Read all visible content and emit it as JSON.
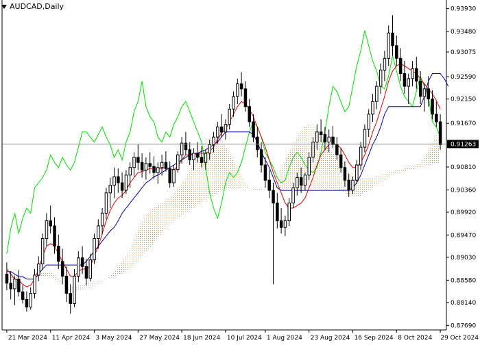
{
  "chart_title": "AUDCAD,Daily",
  "colors": {
    "background": "#ffffff",
    "axis": "#000000",
    "candle": "#000000",
    "tenkan": "#e00000",
    "kijun": "#0000aa",
    "chikou": "#00dd00",
    "cloud_bull": "#d2955a",
    "cloud_bear": "#b0a8c8",
    "price_marker_bg": "#000000",
    "price_marker_text": "#ffffff"
  },
  "chart_data": {
    "type": "candlestick",
    "symbol": "AUDCAD",
    "timeframe": "Daily",
    "indicators": [
      "Ichimoku Kinko Hyo"
    ],
    "ylim": [
      0.876,
      0.941
    ],
    "y_ticks": [
      "0.93930",
      "0.93480",
      "0.93075",
      "0.92590",
      "0.92150",
      "0.91670",
      "0.91263",
      "0.90810",
      "0.90360",
      "0.89920",
      "0.89470",
      "0.89030",
      "0.88580",
      "0.88140",
      "0.87690"
    ],
    "x_ticks": [
      "21 Mar 2024",
      "11 Apr 2024",
      "3 May 2024",
      "27 May 2024",
      "18 Jun 2024",
      "10 Jul 2024",
      "1 Aug 2024",
      "23 Aug 2024",
      "16 Sep 2024",
      "8 Oct 2024",
      "29 Oct 2024"
    ],
    "current_price": "0.91263",
    "candles": [
      [
        0.887,
        0.8893,
        0.8838,
        0.8852
      ],
      [
        0.8852,
        0.8875,
        0.882,
        0.8841
      ],
      [
        0.8841,
        0.8866,
        0.8809,
        0.886
      ],
      [
        0.886,
        0.8878,
        0.8826,
        0.8835
      ],
      [
        0.8835,
        0.8848,
        0.8812,
        0.882
      ],
      [
        0.882,
        0.8836,
        0.8796,
        0.8805
      ],
      [
        0.8805,
        0.8844,
        0.88,
        0.8832
      ],
      [
        0.8832,
        0.888,
        0.8822,
        0.8868
      ],
      [
        0.8868,
        0.8905,
        0.8856,
        0.889
      ],
      [
        0.889,
        0.895,
        0.8878,
        0.894
      ],
      [
        0.894,
        0.899,
        0.8926,
        0.8975
      ],
      [
        0.8975,
        0.9005,
        0.895,
        0.8965
      ],
      [
        0.8965,
        0.8982,
        0.891,
        0.8925
      ],
      [
        0.8925,
        0.8948,
        0.888,
        0.8895
      ],
      [
        0.8895,
        0.892,
        0.885,
        0.8866
      ],
      [
        0.8866,
        0.8885,
        0.8815,
        0.8832
      ],
      [
        0.8832,
        0.885,
        0.8792,
        0.8812
      ],
      [
        0.8812,
        0.888,
        0.8805,
        0.8866
      ],
      [
        0.8866,
        0.8915,
        0.8854,
        0.8902
      ],
      [
        0.8902,
        0.8925,
        0.887,
        0.8885
      ],
      [
        0.8885,
        0.89,
        0.8848,
        0.8862
      ],
      [
        0.8862,
        0.891,
        0.8856,
        0.8898
      ],
      [
        0.8898,
        0.895,
        0.889,
        0.894
      ],
      [
        0.894,
        0.8978,
        0.892,
        0.8965
      ],
      [
        0.8965,
        0.9,
        0.8948,
        0.899
      ],
      [
        0.899,
        0.904,
        0.8978,
        0.903
      ],
      [
        0.903,
        0.906,
        0.9,
        0.9045
      ],
      [
        0.9045,
        0.908,
        0.902,
        0.9062
      ],
      [
        0.9062,
        0.9078,
        0.903,
        0.905
      ],
      [
        0.905,
        0.907,
        0.902,
        0.9035
      ],
      [
        0.9035,
        0.9075,
        0.9028,
        0.9065
      ],
      [
        0.9065,
        0.909,
        0.904,
        0.908
      ],
      [
        0.908,
        0.911,
        0.9062,
        0.91
      ],
      [
        0.91,
        0.9125,
        0.9075,
        0.909
      ],
      [
        0.909,
        0.9108,
        0.906,
        0.9075
      ],
      [
        0.9075,
        0.91,
        0.9056,
        0.9088
      ],
      [
        0.9088,
        0.911,
        0.9068,
        0.9082
      ],
      [
        0.9082,
        0.9102,
        0.9058,
        0.907
      ],
      [
        0.907,
        0.909,
        0.9048,
        0.908
      ],
      [
        0.908,
        0.9105,
        0.9064,
        0.909
      ],
      [
        0.909,
        0.9112,
        0.9072,
        0.9078
      ],
      [
        0.9078,
        0.9092,
        0.904,
        0.905
      ],
      [
        0.905,
        0.9085,
        0.9042,
        0.9076
      ],
      [
        0.9076,
        0.9112,
        0.907,
        0.9105
      ],
      [
        0.9105,
        0.914,
        0.9088,
        0.9128
      ],
      [
        0.9128,
        0.915,
        0.9105,
        0.9115
      ],
      [
        0.9115,
        0.913,
        0.9085,
        0.9095
      ],
      [
        0.9095,
        0.9118,
        0.9075,
        0.9108
      ],
      [
        0.9108,
        0.913,
        0.909,
        0.91
      ],
      [
        0.91,
        0.9122,
        0.908,
        0.909
      ],
      [
        0.909,
        0.9115,
        0.9075,
        0.9108
      ],
      [
        0.9108,
        0.9135,
        0.9095,
        0.9125
      ],
      [
        0.9125,
        0.915,
        0.911,
        0.914
      ],
      [
        0.914,
        0.917,
        0.9125,
        0.916
      ],
      [
        0.916,
        0.9185,
        0.914,
        0.915
      ],
      [
        0.915,
        0.9175,
        0.9135,
        0.9165
      ],
      [
        0.9165,
        0.9205,
        0.9155,
        0.9195
      ],
      [
        0.9195,
        0.923,
        0.918,
        0.922
      ],
      [
        0.922,
        0.9255,
        0.9205,
        0.9245
      ],
      [
        0.9245,
        0.9268,
        0.922,
        0.9235
      ],
      [
        0.9235,
        0.925,
        0.919,
        0.92
      ],
      [
        0.92,
        0.9215,
        0.916,
        0.917
      ],
      [
        0.917,
        0.9185,
        0.913,
        0.914
      ],
      [
        0.914,
        0.916,
        0.91,
        0.9115
      ],
      [
        0.9115,
        0.913,
        0.907,
        0.9085
      ],
      [
        0.9085,
        0.91,
        0.904,
        0.9055
      ],
      [
        0.9055,
        0.9075,
        0.902,
        0.9035
      ],
      [
        0.9035,
        0.905,
        0.885,
        0.901
      ],
      [
        0.901,
        0.903,
        0.896,
        0.8975
      ],
      [
        0.8975,
        0.9,
        0.895,
        0.8962
      ],
      [
        0.8962,
        0.8985,
        0.8945,
        0.8975
      ],
      [
        0.8975,
        0.902,
        0.8965,
        0.901
      ],
      [
        0.901,
        0.905,
        0.9,
        0.904
      ],
      [
        0.904,
        0.907,
        0.9025,
        0.906
      ],
      [
        0.906,
        0.908,
        0.903,
        0.9045
      ],
      [
        0.9045,
        0.907,
        0.9035,
        0.9065
      ],
      [
        0.9065,
        0.911,
        0.9055,
        0.91
      ],
      [
        0.91,
        0.914,
        0.909,
        0.913
      ],
      [
        0.913,
        0.9165,
        0.9115,
        0.915
      ],
      [
        0.915,
        0.9175,
        0.913,
        0.9145
      ],
      [
        0.9145,
        0.916,
        0.9115,
        0.913
      ],
      [
        0.913,
        0.9155,
        0.911,
        0.914
      ],
      [
        0.914,
        0.9162,
        0.9118,
        0.9125
      ],
      [
        0.9125,
        0.914,
        0.9095,
        0.9105
      ],
      [
        0.9105,
        0.9118,
        0.907,
        0.908
      ],
      [
        0.908,
        0.9092,
        0.9042,
        0.9055
      ],
      [
        0.9055,
        0.9068,
        0.9022,
        0.9035
      ],
      [
        0.9035,
        0.9062,
        0.9028,
        0.9055
      ],
      [
        0.9055,
        0.9095,
        0.9048,
        0.9085
      ],
      [
        0.9085,
        0.913,
        0.9075,
        0.912
      ],
      [
        0.912,
        0.9165,
        0.911,
        0.9155
      ],
      [
        0.9155,
        0.9195,
        0.914,
        0.9185
      ],
      [
        0.9185,
        0.9225,
        0.917,
        0.921
      ],
      [
        0.921,
        0.925,
        0.9195,
        0.924
      ],
      [
        0.924,
        0.9285,
        0.9225,
        0.9272
      ],
      [
        0.9272,
        0.931,
        0.925,
        0.9295
      ],
      [
        0.9295,
        0.936,
        0.928,
        0.9345
      ],
      [
        0.9345,
        0.938,
        0.93,
        0.932
      ],
      [
        0.932,
        0.934,
        0.928,
        0.9295
      ],
      [
        0.9295,
        0.9315,
        0.925,
        0.9265
      ],
      [
        0.9265,
        0.929,
        0.9225,
        0.924
      ],
      [
        0.924,
        0.9265,
        0.9205,
        0.9255
      ],
      [
        0.9255,
        0.929,
        0.924,
        0.9275
      ],
      [
        0.9275,
        0.9298,
        0.9235,
        0.925
      ],
      [
        0.925,
        0.927,
        0.9205,
        0.922
      ],
      [
        0.922,
        0.9245,
        0.919,
        0.9235
      ],
      [
        0.9235,
        0.926,
        0.92,
        0.9215
      ],
      [
        0.9215,
        0.9232,
        0.9175,
        0.9185
      ],
      [
        0.9185,
        0.921,
        0.916,
        0.917
      ],
      [
        0.917,
        0.9185,
        0.9115,
        0.9125
      ]
    ],
    "tenkan": [
      0.888,
      0.887,
      0.886,
      0.8858,
      0.885,
      0.8845,
      0.8848,
      0.886,
      0.888,
      0.8905,
      0.8925,
      0.893,
      0.8925,
      0.891,
      0.8895,
      0.888,
      0.8866,
      0.8866,
      0.8875,
      0.888,
      0.888,
      0.8885,
      0.8905,
      0.8925,
      0.895,
      0.8975,
      0.8995,
      0.901,
      0.902,
      0.9025,
      0.9035,
      0.905,
      0.906,
      0.907,
      0.9072,
      0.9075,
      0.9078,
      0.9078,
      0.9076,
      0.9078,
      0.908,
      0.9076,
      0.9076,
      0.9082,
      0.9095,
      0.9105,
      0.9105,
      0.9105,
      0.9108,
      0.9108,
      0.9108,
      0.9112,
      0.912,
      0.9135,
      0.9148,
      0.9155,
      0.917,
      0.9185,
      0.92,
      0.921,
      0.9205,
      0.9195,
      0.918,
      0.916,
      0.914,
      0.912,
      0.9095,
      0.907,
      0.905,
      0.903,
      0.901,
      0.9,
      0.9,
      0.9005,
      0.901,
      0.902,
      0.904,
      0.906,
      0.9085,
      0.9105,
      0.9115,
      0.9125,
      0.9128,
      0.9125,
      0.9118,
      0.9105,
      0.909,
      0.908,
      0.908,
      0.909,
      0.9105,
      0.9125,
      0.915,
      0.917,
      0.9195,
      0.922,
      0.925,
      0.927,
      0.928,
      0.9285,
      0.928,
      0.9275,
      0.927,
      0.9265,
      0.9255,
      0.9245,
      0.9235,
      0.9225,
      0.9212,
      0.9195
    ],
    "kijun": [
      0.8875,
      0.8875,
      0.887,
      0.8865,
      0.8865,
      0.886,
      0.886,
      0.886,
      0.887,
      0.888,
      0.8888,
      0.8888,
      0.8888,
      0.8888,
      0.8888,
      0.8888,
      0.8888,
      0.8888,
      0.8888,
      0.8888,
      0.8895,
      0.8905,
      0.8915,
      0.8925,
      0.8935,
      0.8945,
      0.8955,
      0.8962,
      0.8975,
      0.899,
      0.9,
      0.901,
      0.902,
      0.903,
      0.904,
      0.905,
      0.9055,
      0.9062,
      0.9065,
      0.907,
      0.9075,
      0.908,
      0.9085,
      0.909,
      0.9095,
      0.91,
      0.9105,
      0.9108,
      0.9108,
      0.9112,
      0.9115,
      0.912,
      0.9125,
      0.913,
      0.914,
      0.915,
      0.915,
      0.915,
      0.915,
      0.915,
      0.915,
      0.915,
      0.9145,
      0.913,
      0.911,
      0.9095,
      0.908,
      0.906,
      0.904,
      0.9035,
      0.9035,
      0.9035,
      0.9035,
      0.9035,
      0.9035,
      0.9035,
      0.9035,
      0.9035,
      0.9035,
      0.9035,
      0.9035,
      0.9035,
      0.9035,
      0.9035,
      0.9035,
      0.9035,
      0.9035,
      0.904,
      0.905,
      0.9065,
      0.9085,
      0.9105,
      0.9125,
      0.914,
      0.916,
      0.9185,
      0.92,
      0.92,
      0.92,
      0.92,
      0.92,
      0.92,
      0.92,
      0.92,
      0.92,
      0.922,
      0.925,
      0.9265,
      0.9265,
      0.9265,
      0.9255,
      0.924
    ],
    "chikou": [
      0.891,
      0.896,
      0.899,
      0.895,
      0.898,
      0.9,
      0.899,
      0.904,
      0.905,
      0.906,
      0.9075,
      0.9105,
      0.909,
      0.908,
      0.91,
      0.9085,
      0.9075,
      0.909,
      0.912,
      0.915,
      0.915,
      0.914,
      0.913,
      0.9145,
      0.916,
      0.914,
      0.9125,
      0.91,
      0.9115,
      0.9095,
      0.913,
      0.915,
      0.919,
      0.921,
      0.925,
      0.92,
      0.918,
      0.917,
      0.914,
      0.913,
      0.915,
      0.914,
      0.9165,
      0.918,
      0.92,
      0.921,
      0.919,
      0.917,
      0.915,
      0.913,
      0.908,
      0.903,
      0.9,
      0.898,
      0.901,
      0.905,
      0.907,
      0.906,
      0.907,
      0.909,
      0.912,
      0.915,
      0.917,
      0.916,
      0.914,
      0.911,
      0.9095,
      0.908,
      0.906,
      0.905,
      0.9055,
      0.908,
      0.91,
      0.911,
      0.91,
      0.9085,
      0.9075,
      0.907,
      0.908,
      0.911,
      0.915,
      0.92,
      0.924,
      0.923,
      0.921,
      0.919,
      0.92,
      0.924,
      0.928,
      0.931,
      0.935,
      0.932,
      0.929,
      0.927,
      0.924,
      0.9235,
      0.926,
      0.93,
      0.927,
      0.924,
      0.922,
      0.921,
      0.92,
      0.923,
      0.926,
      0.924,
      0.922,
      0.917,
      0.916,
      0.914
    ],
    "senkou_a": [
      0.8855,
      0.8858,
      0.886,
      0.886,
      0.886,
      0.8862,
      0.8865,
      0.8868,
      0.887,
      0.8872,
      0.8875,
      0.8875,
      0.887,
      0.8862,
      0.885,
      0.884,
      0.8835,
      0.8833,
      0.8835,
      0.8838,
      0.884,
      0.884,
      0.8845,
      0.885,
      0.8855,
      0.886,
      0.8868,
      0.8875,
      0.8885,
      0.8895,
      0.8905,
      0.892,
      0.894,
      0.896,
      0.8975,
      0.8985,
      0.8995,
      0.9,
      0.9005,
      0.901,
      0.9015,
      0.902,
      0.903,
      0.904,
      0.905,
      0.906,
      0.9075,
      0.909,
      0.9105,
      0.912,
      0.9135,
      0.914,
      0.914,
      0.914,
      0.9135,
      0.9125,
      0.911,
      0.9095,
      0.908,
      0.9065,
      0.905,
      0.904,
      0.9035,
      0.9035,
      0.9035,
      0.904,
      0.9045,
      0.9055,
      0.9065,
      0.908,
      0.9095,
      0.911,
      0.9125,
      0.914,
      0.915,
      0.916,
      0.9165,
      0.916,
      0.915,
      0.914,
      0.913,
      0.912,
      0.911,
      0.91,
      0.909,
      0.908,
      0.9072,
      0.9065,
      0.906,
      0.9058,
      0.9058,
      0.9058,
      0.906,
      0.9062,
      0.9065,
      0.9068,
      0.907,
      0.9072,
      0.9074,
      0.9076,
      0.9078,
      0.908,
      0.9082,
      0.9085,
      0.909,
      0.91,
      0.9115,
      0.913,
      0.9145,
      0.9155
    ],
    "senkou_b": [
      0.887,
      0.887,
      0.8868,
      0.8866,
      0.8866,
      0.8866,
      0.8866,
      0.8866,
      0.8866,
      0.8866,
      0.8866,
      0.8866,
      0.886,
      0.8855,
      0.885,
      0.8845,
      0.8845,
      0.8845,
      0.8848,
      0.885,
      0.8852,
      0.8855,
      0.8855,
      0.8855,
      0.8858,
      0.886,
      0.8862,
      0.8865,
      0.8868,
      0.887,
      0.8875,
      0.888,
      0.8888,
      0.8895,
      0.8905,
      0.8912,
      0.892,
      0.893,
      0.894,
      0.895,
      0.896,
      0.897,
      0.8975,
      0.898,
      0.8985,
      0.899,
      0.8995,
      0.9,
      0.9005,
      0.901,
      0.9015,
      0.902,
      0.9025,
      0.903,
      0.9035,
      0.904,
      0.904,
      0.904,
      0.904,
      0.904,
      0.904,
      0.904,
      0.904,
      0.904,
      0.904,
      0.904,
      0.904,
      0.904,
      0.904,
      0.904,
      0.904,
      0.904,
      0.904,
      0.904,
      0.904,
      0.904,
      0.904,
      0.904,
      0.904,
      0.904,
      0.904,
      0.904,
      0.904,
      0.904,
      0.9035,
      0.903,
      0.9025,
      0.9025,
      0.9025,
      0.9025,
      0.903,
      0.9035,
      0.904,
      0.9045,
      0.905,
      0.9055,
      0.906,
      0.9065,
      0.9068,
      0.907,
      0.9072,
      0.9074,
      0.9076,
      0.9078,
      0.908,
      0.9082,
      0.9084,
      0.9086,
      0.9088,
      0.909
    ]
  }
}
